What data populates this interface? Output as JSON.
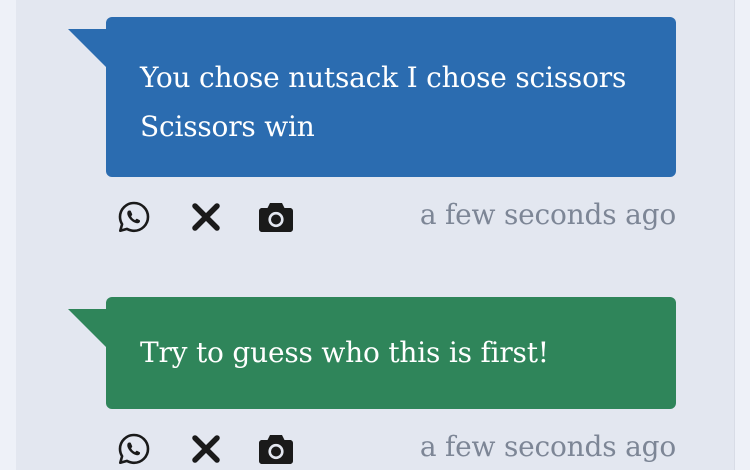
{
  "messages": [
    {
      "text": "You chose nutsack I chose scissors\nScissors win",
      "color": "#2b6cb0",
      "timestamp": "a few seconds ago",
      "actions": [
        "whatsapp-icon",
        "x-icon",
        "camera-icon"
      ]
    },
    {
      "text": "Try to guess who this is first!",
      "color": "#2f855a",
      "timestamp": "a few seconds ago",
      "actions": [
        "whatsapp-icon",
        "x-icon",
        "camera-icon"
      ]
    }
  ],
  "colors": {
    "background": "#eef1f8",
    "panel": "#e3e7f0",
    "timestamp_text": "#7d8696",
    "icon": "#1a1a1a"
  }
}
